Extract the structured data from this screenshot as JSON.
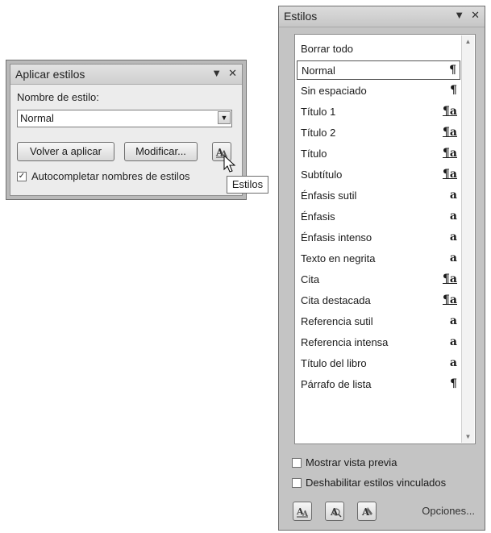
{
  "apply_panel": {
    "title": "Aplicar estilos",
    "name_label": "Nombre de estilo:",
    "style_value": "Normal",
    "reapply_label": "Volver a aplicar",
    "modify_label": "Modificar...",
    "autocomplete_label": "Autocompletar nombres de estilos",
    "autocomplete_checked": true,
    "tooltip": "Estilos"
  },
  "styles_panel": {
    "title": "Estilos",
    "items": [
      {
        "label": "Borrar todo",
        "symbol": ""
      },
      {
        "label": "Normal",
        "symbol": "¶",
        "selected": true
      },
      {
        "label": "Sin espaciado",
        "symbol": "¶"
      },
      {
        "label": "Título 1",
        "symbol": "¶a"
      },
      {
        "label": "Título 2",
        "symbol": "¶a"
      },
      {
        "label": "Título",
        "symbol": "¶a"
      },
      {
        "label": "Subtítulo",
        "symbol": "¶a"
      },
      {
        "label": "Énfasis sutil",
        "symbol": "a"
      },
      {
        "label": "Énfasis",
        "symbol": "a"
      },
      {
        "label": "Énfasis intenso",
        "symbol": "a"
      },
      {
        "label": "Texto en negrita",
        "symbol": "a"
      },
      {
        "label": "Cita",
        "symbol": "¶a"
      },
      {
        "label": "Cita destacada",
        "symbol": "¶a"
      },
      {
        "label": "Referencia sutil",
        "symbol": "a"
      },
      {
        "label": "Referencia intensa",
        "symbol": "a"
      },
      {
        "label": "Título del libro",
        "symbol": "a"
      },
      {
        "label": "Párrafo de lista",
        "symbol": "¶"
      }
    ],
    "show_preview_label": "Mostrar vista previa",
    "disable_linked_label": "Deshabilitar estilos vinculados",
    "options_label": "Opciones..."
  }
}
